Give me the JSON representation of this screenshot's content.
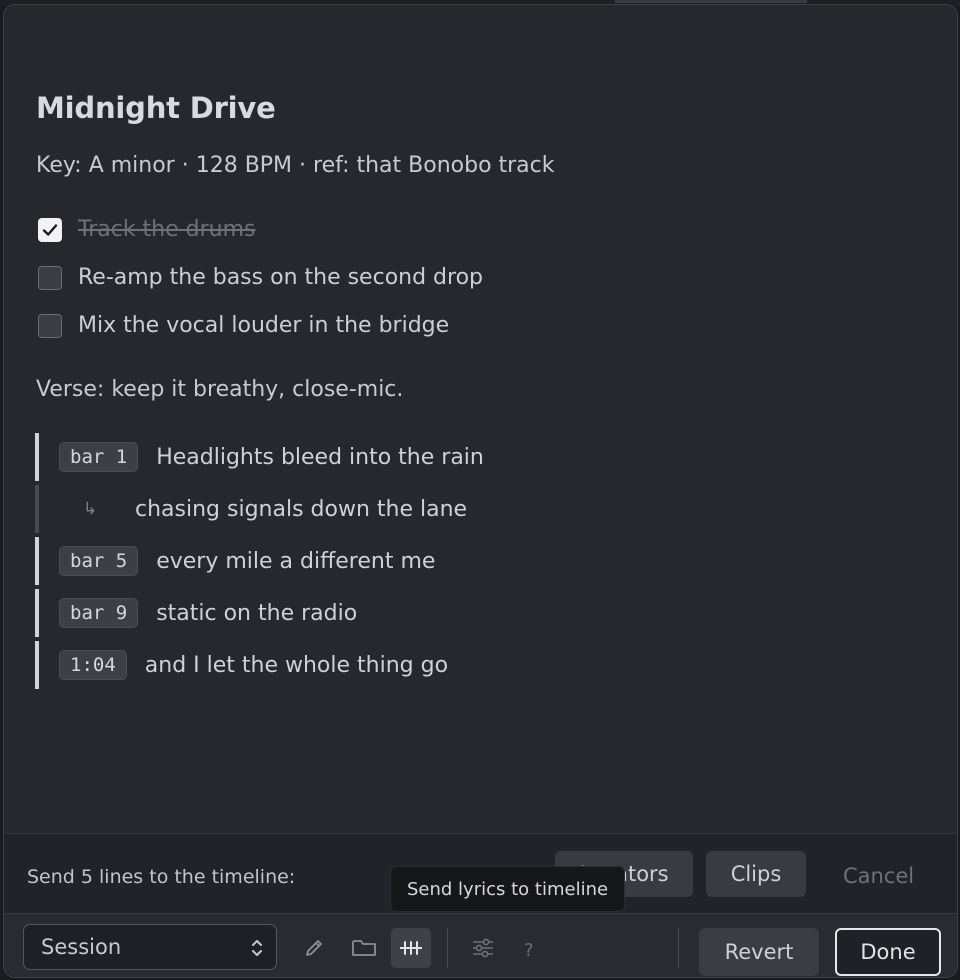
{
  "note": {
    "title": "Midnight Drive",
    "meta": "Key: A minor · 128 BPM · ref: that Bonobo track",
    "todos": [
      {
        "label": "Track the drums",
        "checked": true
      },
      {
        "label": "Re-amp the bass on the second drop",
        "checked": false
      },
      {
        "label": "Mix the vocal louder in the bridge",
        "checked": false
      }
    ],
    "verse_note": "Verse: keep it breathy, close-mic.",
    "lyrics": [
      {
        "tag": "bar 1",
        "text": "Headlights bleed into the rain"
      },
      {
        "tag": "↳",
        "text": "chasing signals down the lane"
      },
      {
        "tag": "bar 5",
        "text": "every mile a different me"
      },
      {
        "tag": "bar 9",
        "text": "static on the radio"
      },
      {
        "tag": "1:04",
        "text": "and I let the whole thing go"
      }
    ]
  },
  "send_bar": {
    "label": "Send 5 lines to the timeline:",
    "locators_label": "Locators",
    "clips_label": "Clips",
    "cancel_label": "Cancel"
  },
  "tooltip": {
    "text": "Send lyrics to timeline"
  },
  "toolbar": {
    "select_value": "Session",
    "help_label": "?",
    "revert_label": "Revert",
    "done_label": "Done",
    "icons": [
      "pencil-icon",
      "folder-icon",
      "timeline-markers-icon",
      "sliders-icon"
    ]
  },
  "colors": {
    "panel_bg": "#27282e",
    "text": "#d2d3d8",
    "muted": "#6f7178",
    "button_bg": "#393b42"
  }
}
